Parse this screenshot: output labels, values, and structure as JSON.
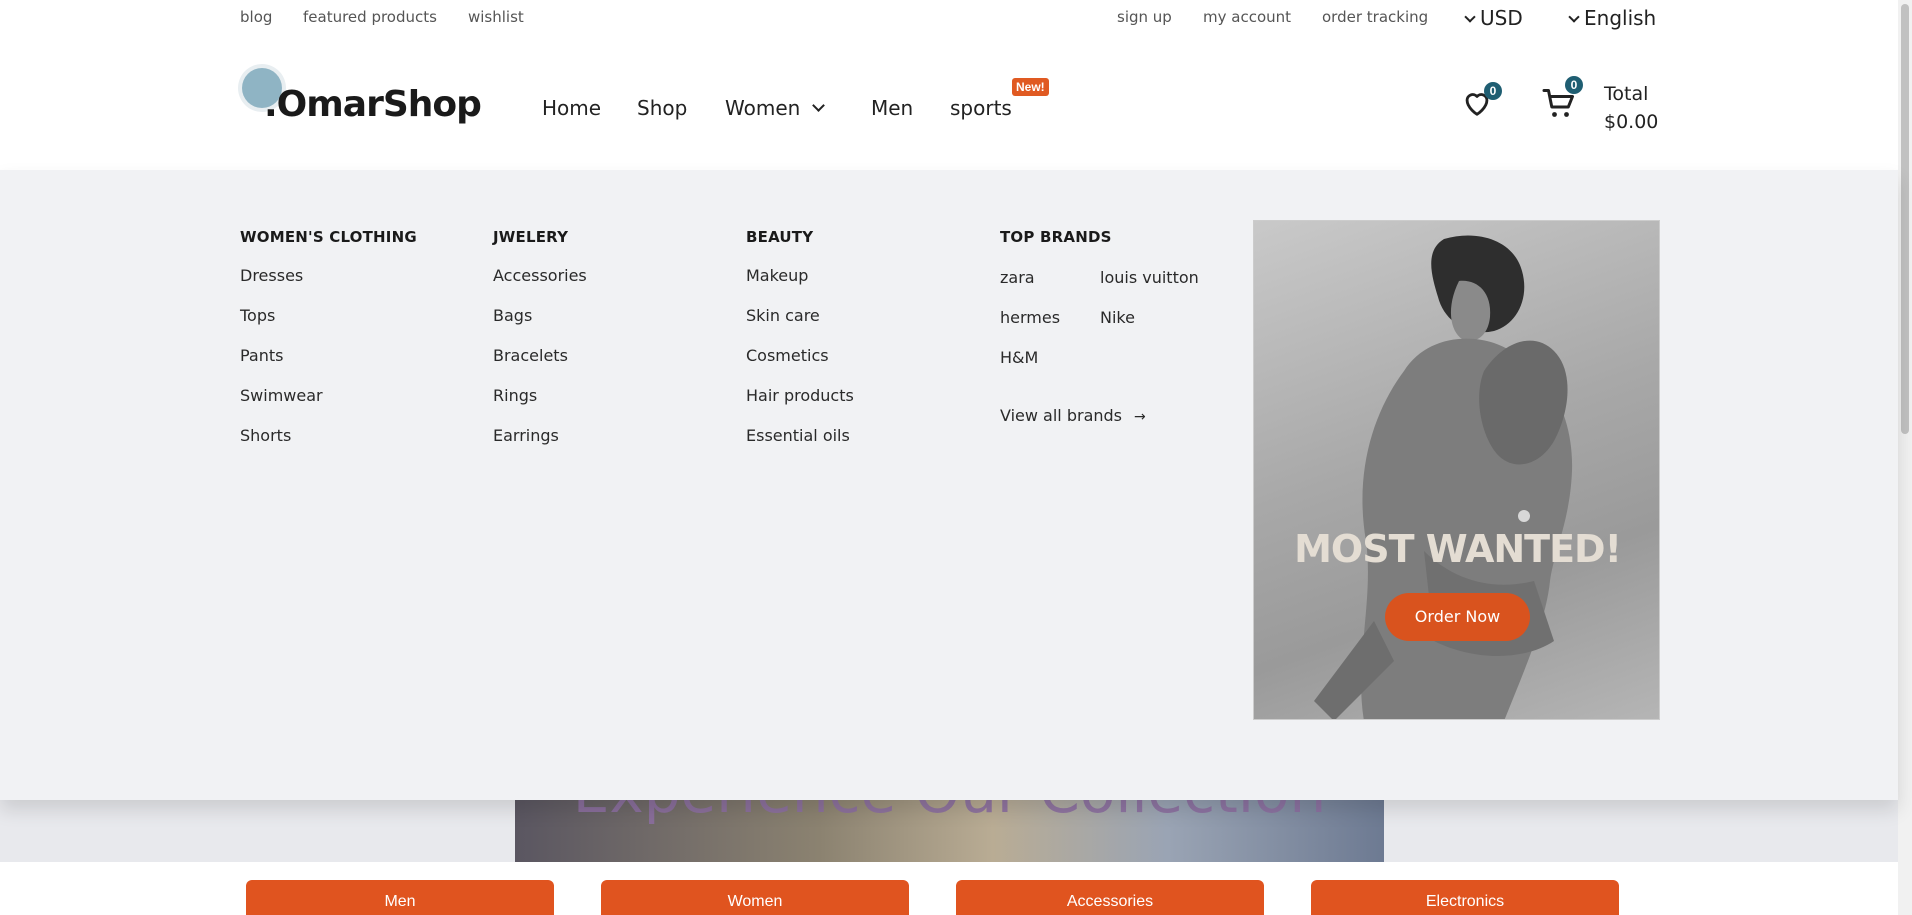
{
  "topbar": {
    "left_links": [
      "blog",
      "featured products",
      "wishlist"
    ],
    "right_links": [
      "sign up",
      "my account",
      "order tracking"
    ],
    "currency": "USD",
    "language": "English"
  },
  "header": {
    "logo_text": ".OmarShop",
    "nav": [
      "Home",
      "Shop",
      "Women",
      "Men",
      "sports"
    ],
    "new_badge": "New!",
    "wishlist_count": "0",
    "cart_count": "0",
    "total_label": "Total",
    "total_value": "$0.00"
  },
  "mega_menu": {
    "columns": [
      {
        "heading": "WOMEN'S CLOTHING",
        "items": [
          "Dresses",
          "Tops",
          "Pants",
          "Swimwear",
          "Shorts"
        ]
      },
      {
        "heading": "JWELERY",
        "items": [
          "Accessories",
          "Bags",
          "Bracelets",
          "Rings",
          "Earrings"
        ]
      },
      {
        "heading": "BEAUTY",
        "items": [
          "Makeup",
          "Skin care",
          "Cosmetics",
          "Hair products",
          "Essential oils"
        ]
      }
    ],
    "brands_heading": "TOP BRANDS",
    "brands": [
      "zara",
      "louis vuitton",
      "hermes",
      "Nike",
      "H&M"
    ],
    "view_all": "View all brands",
    "promo_title": "MOST WANTED!",
    "promo_button": "Order Now"
  },
  "hero": {
    "text": "Experience Our Collection"
  },
  "categories": [
    "Men",
    "Women",
    "Accessories",
    "Electronics"
  ],
  "colors": {
    "accent": "#e0541f",
    "badge": "#1f5e72",
    "menu_bg": "#f1f2f4"
  }
}
